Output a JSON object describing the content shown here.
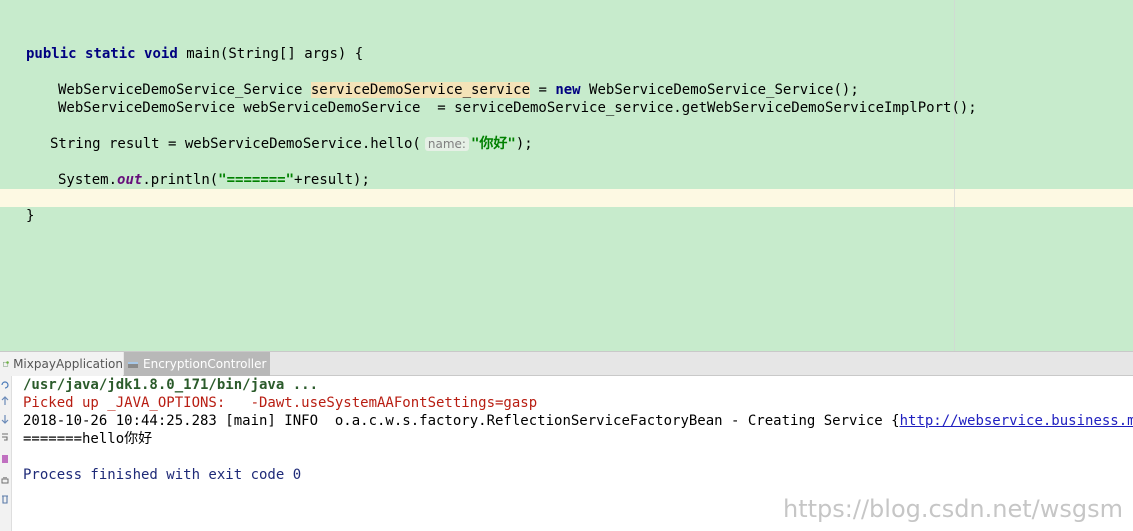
{
  "editor": {
    "lines": {
      "main_sig": [
        "public",
        "static",
        "void",
        "main(String[] args) {"
      ],
      "line_service": [
        "WebServiceDemoService_Service ",
        "serviceDemoService_service",
        " = ",
        "new",
        " WebServiceDemoService_Service();"
      ],
      "line_port": "WebServiceDemoService webServiceDemoService  = serviceDemoService_service.getWebServiceDemoServiceImplPort();",
      "line_result": [
        "String result = webServiceDemoService.hello(",
        "name:",
        "\"你好\"",
        ");"
      ],
      "line_println": [
        "System.",
        "out",
        ".println(",
        "\"=======\"",
        "+result);"
      ],
      "close_brace": "}"
    }
  },
  "run_tabs": [
    {
      "label": "MixpayApplication",
      "icon": "spring-app-icon"
    },
    {
      "label": "EncryptionController",
      "icon": "run-config-icon"
    }
  ],
  "console": {
    "command": "/usr/java/jdk1.8.0_171/bin/java ...",
    "java_options": "Picked up _JAVA_OPTIONS:   -Dawt.useSystemAAFontSettings=gasp",
    "log_prefix": "2018-10-26 10:44:25.283 [main] INFO  o.a.c.w.s.factory.ReflectionServiceFactoryBean - Creating Service {",
    "log_link": "http://webservice.business.mixpay.c",
    "output": "=======hello你好",
    "exit": "Process finished with exit code 0"
  },
  "gutter_icons": [
    "rerun-icon",
    "up-arrow-icon",
    "down-arrow-icon",
    "wrap-icon",
    "pin-icon",
    "print-icon",
    "trash-icon"
  ],
  "watermark": "https://blog.csdn.net/wsgsm"
}
